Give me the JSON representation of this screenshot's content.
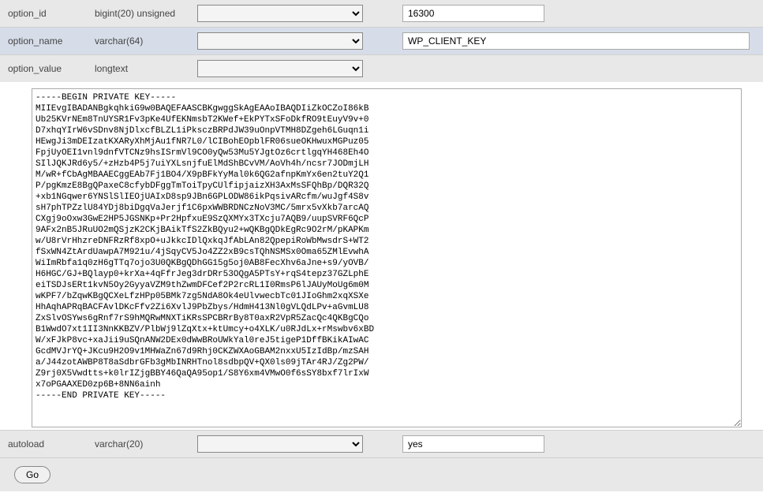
{
  "rows": {
    "option_id": {
      "field": "option_id",
      "type": "bigint(20) unsigned",
      "func": "",
      "value": "16300"
    },
    "option_name": {
      "field": "option_name",
      "type": "varchar(64)",
      "func": "",
      "value": "WP_CLIENT_KEY"
    },
    "option_value": {
      "field": "option_value",
      "type": "longtext",
      "func": "",
      "value": "-----BEGIN PRIVATE KEY-----\nMIIEvgIBADANBgkqhkiG9w0BAQEFAASCBKgwggSkAgEAAoIBAQDIiZkOCZoI86kB\nUb25KVrNEm8TnUYSR1Fv3pKe4UfEKNmsbT2KWef+EkPYTxSFoDkfRO9tEuyV9v+0\nD7xhqYIrW6vSDnv8NjDlxcfBLZL1iPksczBRPdJW39uOnpVTMH8DZgeh6LGuqn1i\nHEwgJi3mDEIzatKXARyXhMjAu1fNR7L0/lCIBohEOpblFR06sueOKHwuxMGPuz05\nFpjUyOEI1vnl9dnfVTCNz9hsISrmVl9CO0yQw53Mu5YJgtOz6crtlgqYH468Eh4O\nSIlJQKJRd6y5/+zHzb4P5j7uiYXLsnjfuElMdShBCvVM/AoVh4h/ncsr7JODmjLH\nM/wR+fCbAgMBAAECggEAb7Fj1BO4/X9pBFkYyMal0k6QG2afnpKmYx6en2tuY2Q1\nP/pgKmzE8BgQPaxeC8cfybDFggTmToiTpyCUlfipjaizXH3AxMsSFQhBp/DQR32Q\n+xb1NGqwer6YNSlSlIEOjUAIxD8sp9JBn6GPLODW86ikPqsivARcfm/wuJgf4S8v\nsH7phTPZzlU84YDj8biDgqVaJerjf1C6pxWWBRDNCzNoV3MC/5mrx5vXkb7arcAQ\nCXgj9oOxw3GwE2HP5JGSNKp+Pr2HpfxuE9SzQXMYx3TXcju7AQB9/uupSVRF6QcP\n9AFx2nB5JRuUO2mQSjzK2CKjBAikTfS2ZkBQyu2+wQKBgQDkEgRc9O2rM/pKAPKm\nw/U8rVrHhzreDNFRzRf8xpO+uJkkcIDlQxkqJfAbLAn82QpepiRoWbMwsdrS+WT2\nfSxWN4ZtArdUawpA7M921u/4jSqyCV5Jo4ZZ2xB9csTQhNSMSx0Oma65ZMlEvwhA\nWiImRbfa1q0zH6gTTq7ojo3U0QKBgQDhGG15g5oj0AB8FecXhv6aJne+s9/yOVB/\nH6HGC/GJ+BQlayp0+krXa+4qFfrJeg3drDRr53OQgA5PTsY+rqS4tepz37GZLphE\neiTSDJsERt1kvN5Oy2GyyaVZM9thZwmDFCef2P2rcRL1I0RmsP6lJAUyMoUg6m0M\nwKPF7/bZqwKBgQCXeLfzHPp05BMk7zg5NdA8Ok4eUlvwecbTc01JIoGhm2xqXSXe\nHhAqhAPRqBACFAvlDKcFfv2Zi6XvlJ9PbZbys/HdmH413Nl0gVLQdLPv+aGvmLU8\nZxSlvOSYws6gRnf7rS9hMQRwMNXTiKRsSPCBRrBy8T0axR2VpR5ZacQc4QKBgCQo\nB1WwdO7xt1II3NnKKBZV/PlbWj9lZqXtx+ktUmcy+o4XLK/u0RJdLx+rMswbv6xBD\nW/xFJkP8vc+xaJii9uSQnANW2DEx0dWwBRoUWkYal0reJ5tigeP1DffBKikAIwAC\nGcdMVJrYQ+JKcu9H2O9v1MHWaZn67d9Rhj0CKZWXAoGBAM2nxxU5IzIdBp/mzSAH\na/J44zotAWBP8T8aSdbrGFb3gMbINRHTnol8sdbpQV+QX0ls09jTAr4RJ/Zg2PW/\nZ9rj0X5Vwdtts+k0lrIZjgBBY46QaQA95op1/S8Y6xm4VMwO0f6sSY8bxf7lrIxW\nx7oPGAAXED0zp6B+8NN6ainh\n-----END PRIVATE KEY-----"
    },
    "autoload": {
      "field": "autoload",
      "type": "varchar(20)",
      "func": "",
      "value": "yes"
    }
  },
  "buttons": {
    "go": "Go"
  }
}
